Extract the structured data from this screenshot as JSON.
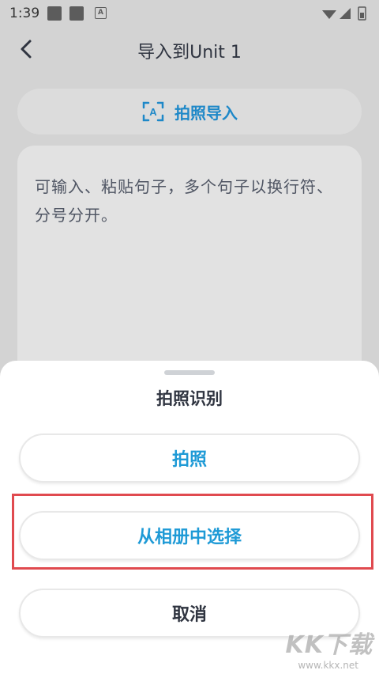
{
  "status_bar": {
    "time": "1:39",
    "notif_icon_letter": "A"
  },
  "header": {
    "title": "导入到Unit 1"
  },
  "photo_import": {
    "label": "拍照导入"
  },
  "text_input": {
    "placeholder": "可输入、粘贴句子，多个句子以换行符、分号分开。"
  },
  "sheet": {
    "title": "拍照识别",
    "take_photo": "拍照",
    "from_album": "从相册中选择",
    "cancel": "取消"
  },
  "watermark": {
    "text": "KK下载",
    "url": "www.kkx.net"
  },
  "colors": {
    "accent": "#1e9ad6",
    "highlight": "#e04a4f"
  }
}
